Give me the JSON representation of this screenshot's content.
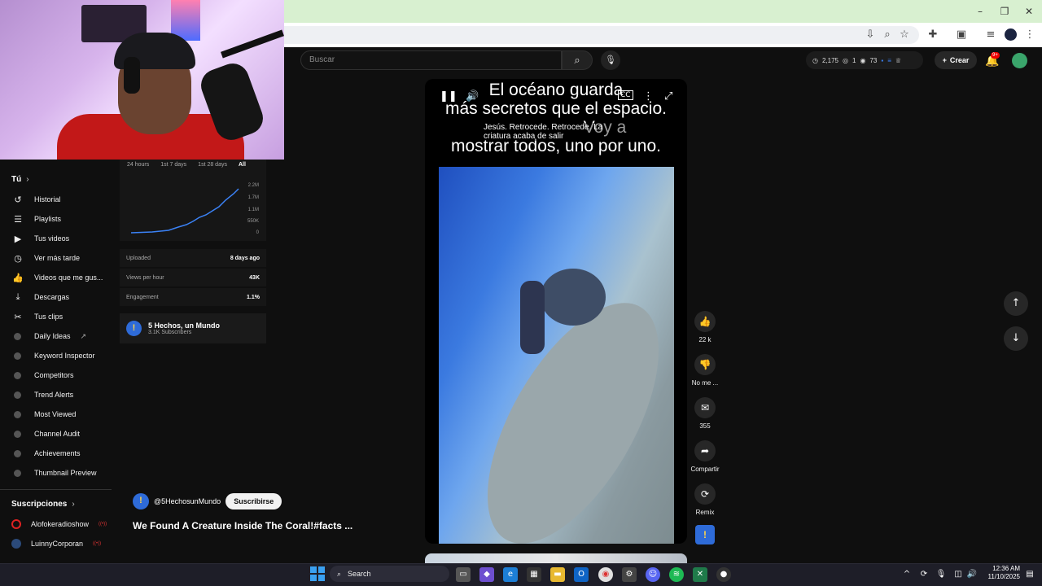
{
  "search": {
    "placeholder": "Buscar"
  },
  "header": {
    "stats": [
      "2,175",
      "1",
      "73"
    ],
    "crear_label": "Crear",
    "notif_badge": "9+"
  },
  "sidebar": {
    "you_heading": "Tú",
    "items": [
      {
        "label": "Historial",
        "icon": "history-icon"
      },
      {
        "label": "Playlists",
        "icon": "playlists-icon"
      },
      {
        "label": "Tus videos",
        "icon": "your-videos-icon"
      },
      {
        "label": "Ver más tarde",
        "icon": "watch-later-icon"
      },
      {
        "label": "Videos que me gus...",
        "icon": "liked-icon"
      },
      {
        "label": "Descargas",
        "icon": "download-icon"
      },
      {
        "label": "Tus clips",
        "icon": "clips-icon"
      }
    ],
    "ext_items": [
      "Daily Ideas",
      "Keyword Inspector",
      "Competitors",
      "Trend Alerts",
      "Most Viewed",
      "Channel Audit",
      "Achievements",
      "Thumbnail Preview"
    ],
    "subs_heading": "Suscripciones",
    "subscriptions": [
      "Alofokeradioshow",
      "LuinnyCorporan"
    ]
  },
  "analytics": {
    "tabs": [
      "24 hours",
      "1st 7 days",
      "1st 28 days",
      "All"
    ],
    "active_tab": "All",
    "y_ticks": [
      "2.2M",
      "1.7M",
      "1.1M",
      "550K",
      "0"
    ],
    "metrics": [
      {
        "label": "Uploaded",
        "value": "8 days ago"
      },
      {
        "label": "Views per hour",
        "value": "43K"
      },
      {
        "label": "Engagement",
        "value": "1.1%"
      }
    ],
    "channel_name": "5 Hechos, un Mundo",
    "channel_subs": "3.1K Subscribers"
  },
  "video": {
    "caption_lines": [
      "El océano guarda",
      "más secretos que el espacio.",
      "Voy a",
      "mostrar todos, uno por uno."
    ],
    "subtitle": "Jesús. Retrocede. Retrocede. La criatura acaba de salir",
    "channel_handle": "@5HechosunMundo",
    "subscribe_label": "Suscribirse",
    "title": "We Found A Creature Inside The Coral!#facts ..."
  },
  "actions": [
    {
      "label": "22 k",
      "icon": "like-icon"
    },
    {
      "label": "No me ...",
      "icon": "dislike-icon"
    },
    {
      "label": "355",
      "icon": "comments-icon"
    },
    {
      "label": "Compartir",
      "icon": "share-icon"
    },
    {
      "label": "Remix",
      "icon": "remix-icon"
    }
  ],
  "taskbar": {
    "search_label": "Search",
    "time": "12:36 AM",
    "date": "11/10/2025"
  }
}
